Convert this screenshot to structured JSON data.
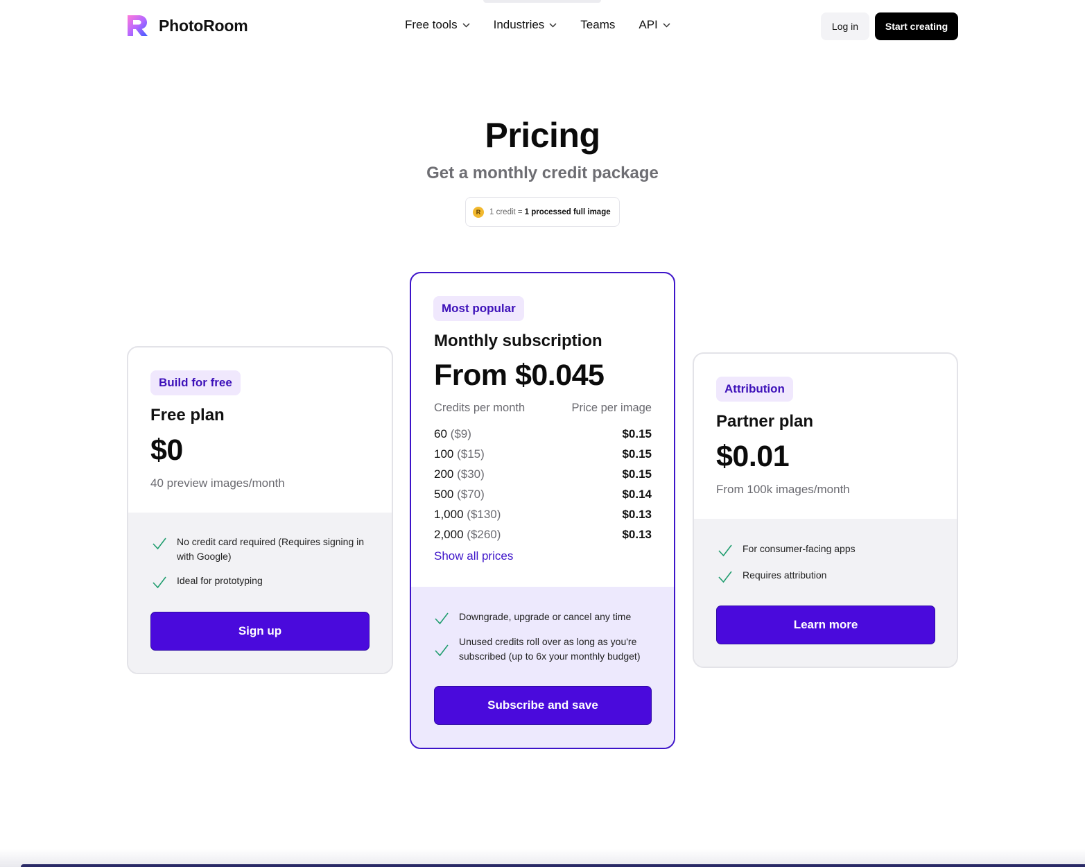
{
  "header": {
    "brand": "PhotoRoom",
    "nav": [
      {
        "label": "Free tools",
        "dropdown": true
      },
      {
        "label": "Industries",
        "dropdown": true
      },
      {
        "label": "Teams",
        "dropdown": false
      },
      {
        "label": "API",
        "dropdown": true
      }
    ],
    "login_label": "Log in",
    "start_label": "Start creating"
  },
  "hero": {
    "title": "Pricing",
    "subtitle": "Get a monthly credit package",
    "credit_prefix": "1 credit =",
    "credit_value": "1 processed full image"
  },
  "plans": {
    "free": {
      "badge": "Build for free",
      "name": "Free plan",
      "price": "$0",
      "note": "40 preview images/month",
      "features": [
        "No credit card required (Requires signing in with Google)",
        "Ideal for prototyping"
      ],
      "cta": "Sign up"
    },
    "monthly": {
      "badge": "Most popular",
      "name": "Monthly subscription",
      "price": "From $0.045",
      "col_credits": "Credits per month",
      "col_price": "Price per image",
      "rows": [
        {
          "credits": "60",
          "cost": "($9)",
          "ppi": "$0.15"
        },
        {
          "credits": "100",
          "cost": "($15)",
          "ppi": "$0.15"
        },
        {
          "credits": "200",
          "cost": "($30)",
          "ppi": "$0.15"
        },
        {
          "credits": "500",
          "cost": "($70)",
          "ppi": "$0.14"
        },
        {
          "credits": "1,000",
          "cost": "($130)",
          "ppi": "$0.13"
        },
        {
          "credits": "2,000",
          "cost": "($260)",
          "ppi": "$0.13"
        }
      ],
      "show_all": "Show all prices",
      "features": [
        "Downgrade, upgrade or cancel any time",
        "Unused credits roll over as long as you're subscribed (up to 6x your monthly budget)"
      ],
      "cta": "Subscribe and save"
    },
    "partner": {
      "badge": "Attribution",
      "name": "Partner plan",
      "price": "$0.01",
      "note": "From 100k images/month",
      "features": [
        "For consumer-facing apps",
        "Requires attribution"
      ],
      "cta": "Learn more"
    }
  },
  "colors": {
    "accent": "#4a0adc",
    "badge_bg": "#f0e8fd",
    "check": "#1f9d6e"
  }
}
